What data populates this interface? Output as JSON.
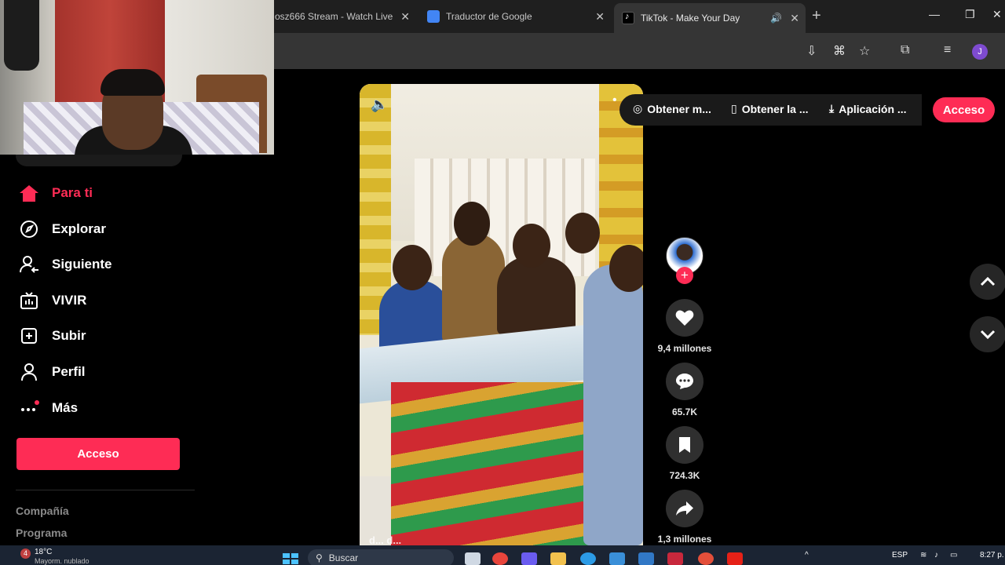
{
  "browser": {
    "tabs": [
      {
        "title": "osz666 Stream - Watch Live o",
        "close": "✕"
      },
      {
        "title": "Traductor de Google",
        "close": "✕"
      },
      {
        "title": "TikTok - Make Your Day",
        "close": "✕",
        "active": true
      }
    ],
    "new_tab": "+",
    "window_controls": [
      "—",
      "❐",
      "✕"
    ],
    "profile_initial": "J"
  },
  "sidebar": {
    "items": [
      {
        "label": "Para ti",
        "icon": "home-icon",
        "active": true
      },
      {
        "label": "Explorar",
        "icon": "compass-icon"
      },
      {
        "label": "Siguiente",
        "icon": "following-icon"
      },
      {
        "label": "VIVIR",
        "icon": "live-icon"
      },
      {
        "label": "Subir",
        "icon": "upload-icon"
      },
      {
        "label": "Perfil",
        "icon": "profile-icon"
      },
      {
        "label": "Más",
        "icon": "more-icon"
      }
    ],
    "login_label": "Acceso",
    "footer_links": [
      "Compañía",
      "Programa"
    ]
  },
  "header": {
    "pills": [
      {
        "label": "Obtener m...",
        "icon": "coin-icon"
      },
      {
        "label": "Obtener la ...",
        "icon": "phone-icon"
      },
      {
        "label": "Aplicación ...",
        "icon": "download-icon"
      }
    ],
    "login_label": "Acceso"
  },
  "video": {
    "caption": "d... d..."
  },
  "actions": {
    "likes": "9,4 millones",
    "comments": "65.7K",
    "saves": "724.3K",
    "shares": "1,3 millones"
  },
  "taskbar": {
    "temperature": "18°C",
    "weather_sub": "Mayorm. nublado",
    "notification_count": "4",
    "search_label": "Buscar",
    "language": "ESP",
    "time": "8:27 p."
  },
  "colors": {
    "brand": "#fe2c55",
    "chrome_dark": "#1f1f1f",
    "toolbar": "#353535"
  }
}
